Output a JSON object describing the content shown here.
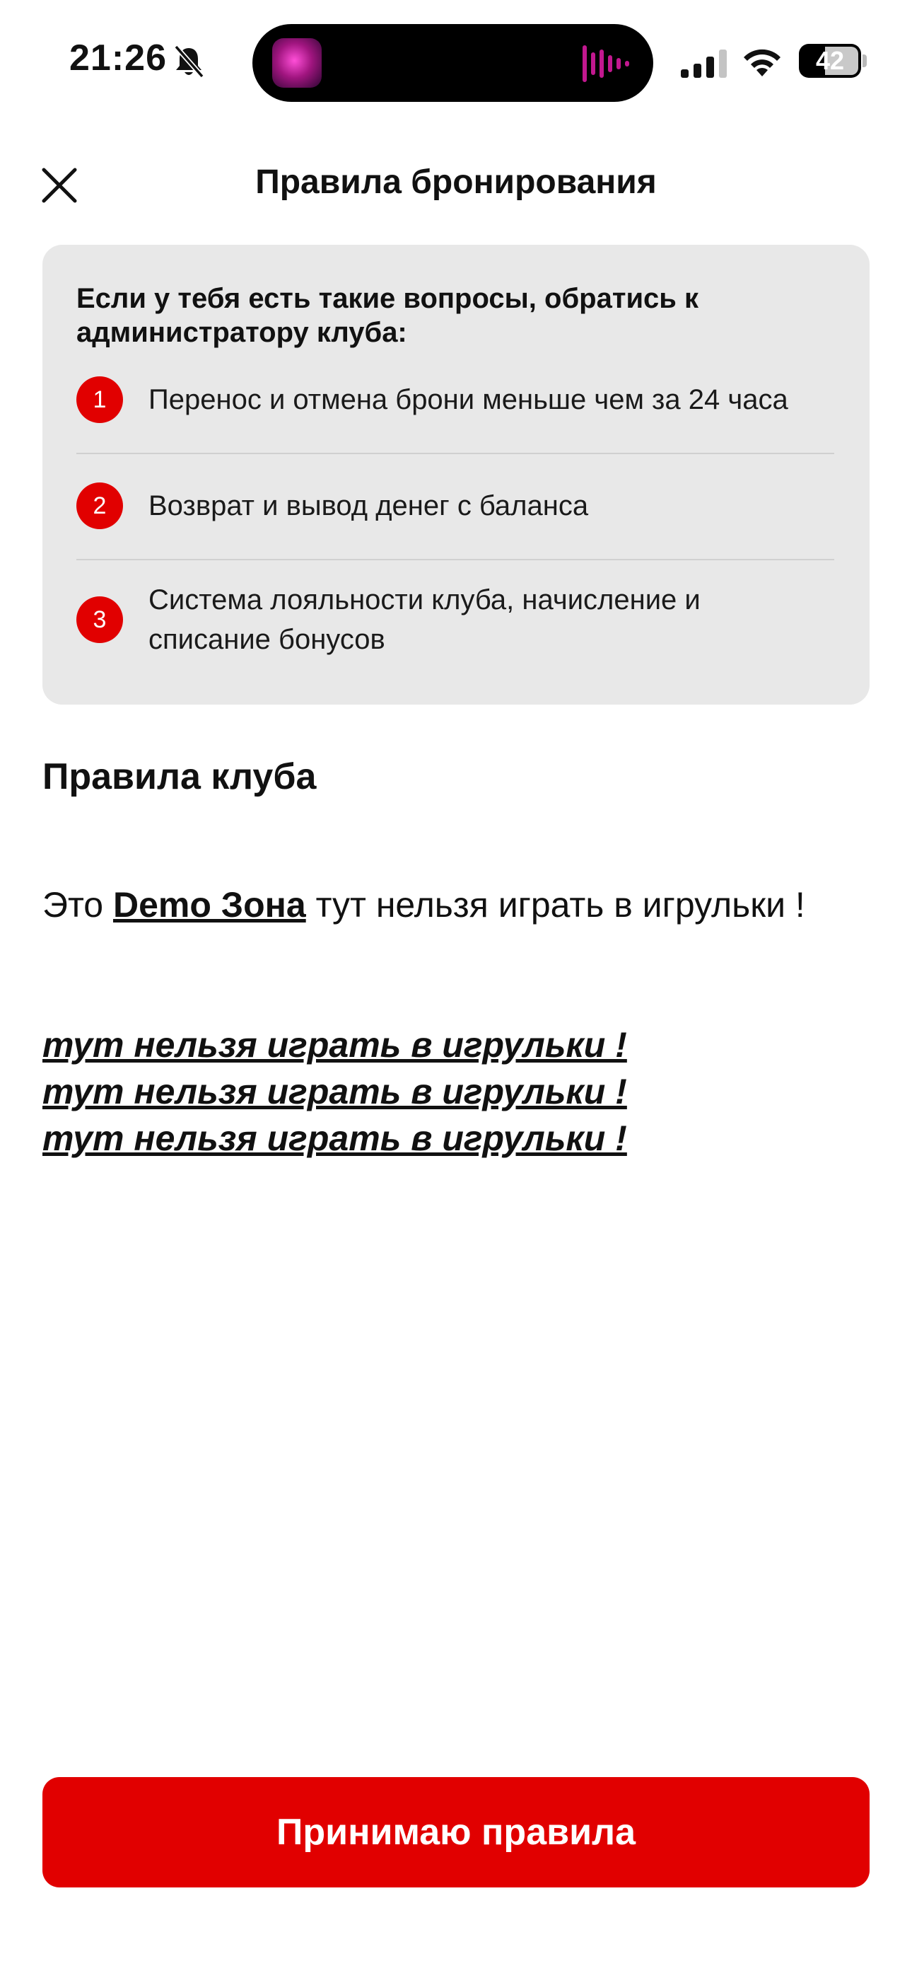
{
  "status_bar": {
    "time": "21:26",
    "battery": "42",
    "icons": [
      "bell-slash-icon",
      "signal-icon",
      "wifi-icon",
      "battery-icon"
    ]
  },
  "header": {
    "title": "Правила бронирования",
    "close_icon": "close-icon"
  },
  "info_card": {
    "intro": "Если у тебя есть такие вопросы, обратись к администратору клуба:",
    "items": [
      {
        "number": "1",
        "text": "Перенос и отмена брони меньше чем за 24 часа"
      },
      {
        "number": "2",
        "text": "Возврат и вывод денег с баланса"
      },
      {
        "number": "3",
        "text_line1": "Система лояльности клуба, начисление и",
        "text_line2": "списание бонусов"
      }
    ]
  },
  "club_rules": {
    "title": "Правила клуба",
    "line_prefix": "Это ",
    "brand": "Demo Зона",
    "line_suffix": " тут нельзя играть в игрульки !",
    "italic_lines": [
      "тут нельзя играть в игрульки !",
      "тут нельзя играть в игрульки !",
      "тут нельзя играть в игрульки !"
    ]
  },
  "accept_button": {
    "label": "Принимаю правила"
  },
  "colors": {
    "accent": "#e10000",
    "card_bg": "#e8e8e8"
  }
}
